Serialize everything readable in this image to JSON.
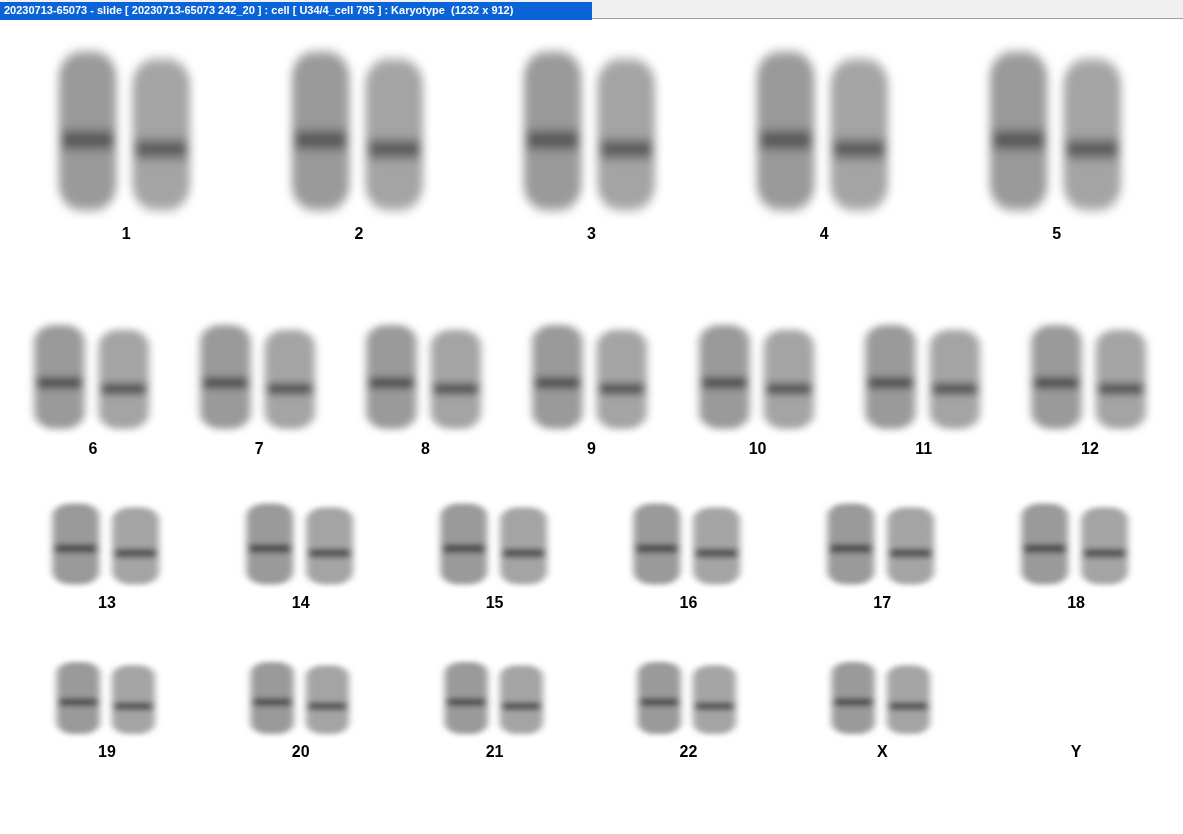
{
  "window": {
    "title": "20230713-65073 - slide [ 20230713-65073 242_20 ] : cell [ U34/4_cell 795 ] : Karyotype  (1232 x 912)"
  },
  "karyotype": {
    "rows": [
      {
        "pairs": [
          {
            "label": "1",
            "present": true
          },
          {
            "label": "2",
            "present": true
          },
          {
            "label": "3",
            "present": true
          },
          {
            "label": "4",
            "present": true
          },
          {
            "label": "5",
            "present": true
          }
        ]
      },
      {
        "pairs": [
          {
            "label": "6",
            "present": true
          },
          {
            "label": "7",
            "present": true
          },
          {
            "label": "8",
            "present": true
          },
          {
            "label": "9",
            "present": true
          },
          {
            "label": "10",
            "present": true
          },
          {
            "label": "11",
            "present": true
          },
          {
            "label": "12",
            "present": true
          }
        ]
      },
      {
        "pairs": [
          {
            "label": "13",
            "present": true
          },
          {
            "label": "14",
            "present": true
          },
          {
            "label": "15",
            "present": true
          },
          {
            "label": "16",
            "present": true
          },
          {
            "label": "17",
            "present": true
          },
          {
            "label": "18",
            "present": true
          }
        ]
      },
      {
        "pairs": [
          {
            "label": "19",
            "present": true
          },
          {
            "label": "20",
            "present": true
          },
          {
            "label": "21",
            "present": true
          },
          {
            "label": "22",
            "present": true
          },
          {
            "label": "X",
            "present": true
          },
          {
            "label": "Y",
            "present": false
          }
        ]
      }
    ]
  }
}
